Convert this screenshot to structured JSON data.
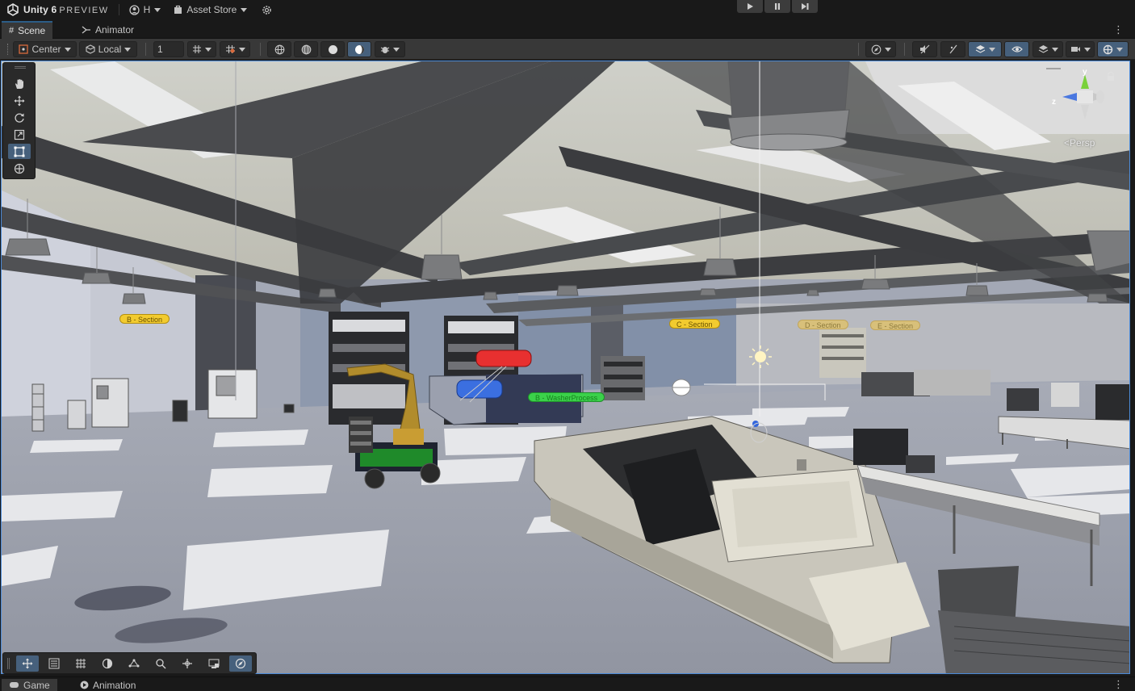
{
  "app": {
    "title": "Unity 6",
    "title_suffix": "PREVIEW",
    "account_label": "H",
    "asset_store_label": "Asset Store"
  },
  "tabs": [
    {
      "label": "Scene",
      "icon": "grid-icon",
      "active": true
    },
    {
      "label": "Animator",
      "icon": "animator-icon",
      "active": false
    }
  ],
  "scene_toolbar": {
    "pivot_label": "Center",
    "space_label": "Local",
    "snap_value": "1"
  },
  "scene": {
    "section_labels": [
      {
        "text": "B - Section",
        "color": "yellow"
      },
      {
        "text": "C - Section",
        "color": "yellow"
      },
      {
        "text": "D - Section",
        "color": "yellow-faded"
      },
      {
        "text": "E - Section",
        "color": "yellow-faded"
      }
    ],
    "process_label": {
      "text": "B - WasherProcess",
      "color": "green"
    }
  },
  "gizmo": {
    "y_label": "y",
    "z_label": "z",
    "projection_label": "Persp"
  },
  "bottom_tabs": [
    {
      "label": "Game",
      "icon": "game-controller-icon",
      "active": true
    },
    {
      "label": "Animation",
      "icon": "animation-icon",
      "active": false
    }
  ],
  "colors": {
    "accent": "#46607c",
    "viewport_border": "#4b8ad8",
    "label_yellow": "#f2cb2f",
    "label_green": "#3bd14a"
  }
}
